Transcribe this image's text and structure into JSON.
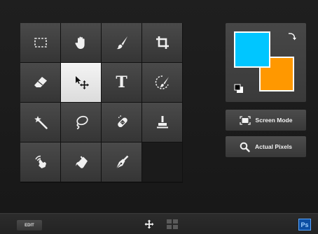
{
  "tools": [
    {
      "name": "marquee-tool",
      "icon": "rectangular-marquee-icon"
    },
    {
      "name": "hand-tool",
      "icon": "hand-icon"
    },
    {
      "name": "brush-tool",
      "icon": "brush-icon"
    },
    {
      "name": "crop-tool",
      "icon": "crop-icon"
    },
    {
      "name": "eraser-tool",
      "icon": "eraser-icon"
    },
    {
      "name": "move-tool",
      "icon": "move-icon",
      "selected": true
    },
    {
      "name": "type-tool",
      "icon": "type-icon",
      "glyph": "T"
    },
    {
      "name": "quick-selection-tool",
      "icon": "quick-selection-icon"
    },
    {
      "name": "magic-wand-tool",
      "icon": "magic-wand-icon"
    },
    {
      "name": "lasso-tool",
      "icon": "lasso-icon"
    },
    {
      "name": "healing-brush-tool",
      "icon": "healing-bandage-icon"
    },
    {
      "name": "clone-stamp-tool",
      "icon": "stamp-icon"
    },
    {
      "name": "smudge-tool",
      "icon": "smudge-finger-icon"
    },
    {
      "name": "paint-bucket-tool",
      "icon": "paint-bucket-icon"
    },
    {
      "name": "pen-tool",
      "icon": "pen-nib-icon"
    }
  ],
  "colors": {
    "foreground": "#00c6ff",
    "background": "#ff9800",
    "panel": "#3f3f3f",
    "app_bg": "#1b1b1b"
  },
  "buttons": {
    "screen_mode": "Screen Mode",
    "actual_pixels": "Actual Pixels"
  },
  "bottom_bar": {
    "edit_label": "EDIT",
    "logo_text": "Ps"
  }
}
